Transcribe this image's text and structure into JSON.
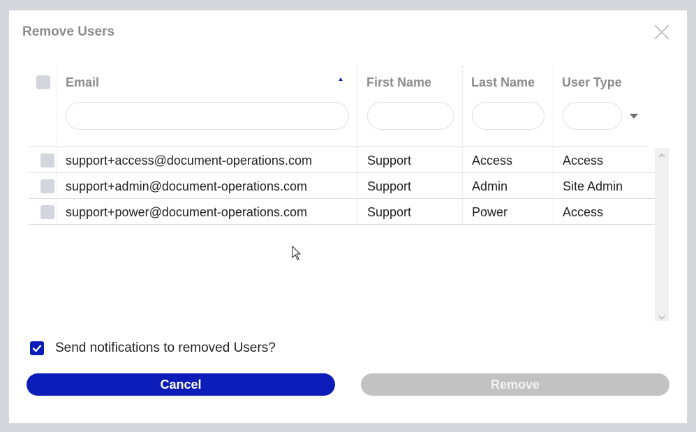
{
  "dialog": {
    "title": "Remove Users",
    "close_icon": "close-icon"
  },
  "table": {
    "columns": [
      {
        "label": "Email",
        "sort": "ascending"
      },
      {
        "label": "First Name"
      },
      {
        "label": "Last Name"
      },
      {
        "label": "User Type"
      }
    ],
    "filters": {
      "email": "",
      "first_name": "",
      "last_name": "",
      "user_type": ""
    },
    "rows": [
      {
        "email": "support+access@document-operations.com",
        "first_name": "Support",
        "last_name": "Access",
        "user_type": "Access"
      },
      {
        "email": "support+admin@document-operations.com",
        "first_name": "Support",
        "last_name": "Admin",
        "user_type": "Site Admin"
      },
      {
        "email": "support+power@document-operations.com",
        "first_name": "Support",
        "last_name": "Power",
        "user_type": "Access"
      }
    ]
  },
  "notify": {
    "label": "Send notifications to removed Users?",
    "checked": true
  },
  "buttons": {
    "cancel": "Cancel",
    "remove": "Remove"
  },
  "colors": {
    "accent": "#0c1cb8",
    "disabled": "#c2c2c2",
    "overlay": "#d5d7dc"
  }
}
